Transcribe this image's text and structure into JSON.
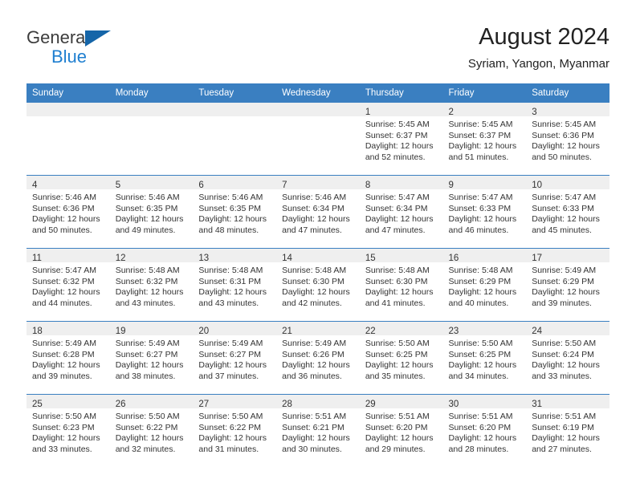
{
  "brand": {
    "line1": "General",
    "line2": "Blue",
    "flag_icon": "triangle-flag-icon",
    "accent_color": "#1565a8",
    "blue_text_color": "#1f7fd0"
  },
  "header": {
    "title": "August 2024",
    "subtitle": "Syriam, Yangon, Myanmar"
  },
  "calendar": {
    "header_bg": "#3a7fc1",
    "header_text_color": "#ffffff",
    "daynum_strip_bg": "#efefef",
    "weekday_headers": [
      "Sunday",
      "Monday",
      "Tuesday",
      "Wednesday",
      "Thursday",
      "Friday",
      "Saturday"
    ],
    "weeks": [
      [
        {
          "day": "",
          "sunrise": "",
          "sunset": "",
          "daylight1": "",
          "daylight2": ""
        },
        {
          "day": "",
          "sunrise": "",
          "sunset": "",
          "daylight1": "",
          "daylight2": ""
        },
        {
          "day": "",
          "sunrise": "",
          "sunset": "",
          "daylight1": "",
          "daylight2": ""
        },
        {
          "day": "",
          "sunrise": "",
          "sunset": "",
          "daylight1": "",
          "daylight2": ""
        },
        {
          "day": "1",
          "sunrise": "Sunrise: 5:45 AM",
          "sunset": "Sunset: 6:37 PM",
          "daylight1": "Daylight: 12 hours",
          "daylight2": "and 52 minutes."
        },
        {
          "day": "2",
          "sunrise": "Sunrise: 5:45 AM",
          "sunset": "Sunset: 6:37 PM",
          "daylight1": "Daylight: 12 hours",
          "daylight2": "and 51 minutes."
        },
        {
          "day": "3",
          "sunrise": "Sunrise: 5:45 AM",
          "sunset": "Sunset: 6:36 PM",
          "daylight1": "Daylight: 12 hours",
          "daylight2": "and 50 minutes."
        }
      ],
      [
        {
          "day": "4",
          "sunrise": "Sunrise: 5:46 AM",
          "sunset": "Sunset: 6:36 PM",
          "daylight1": "Daylight: 12 hours",
          "daylight2": "and 50 minutes."
        },
        {
          "day": "5",
          "sunrise": "Sunrise: 5:46 AM",
          "sunset": "Sunset: 6:35 PM",
          "daylight1": "Daylight: 12 hours",
          "daylight2": "and 49 minutes."
        },
        {
          "day": "6",
          "sunrise": "Sunrise: 5:46 AM",
          "sunset": "Sunset: 6:35 PM",
          "daylight1": "Daylight: 12 hours",
          "daylight2": "and 48 minutes."
        },
        {
          "day": "7",
          "sunrise": "Sunrise: 5:46 AM",
          "sunset": "Sunset: 6:34 PM",
          "daylight1": "Daylight: 12 hours",
          "daylight2": "and 47 minutes."
        },
        {
          "day": "8",
          "sunrise": "Sunrise: 5:47 AM",
          "sunset": "Sunset: 6:34 PM",
          "daylight1": "Daylight: 12 hours",
          "daylight2": "and 47 minutes."
        },
        {
          "day": "9",
          "sunrise": "Sunrise: 5:47 AM",
          "sunset": "Sunset: 6:33 PM",
          "daylight1": "Daylight: 12 hours",
          "daylight2": "and 46 minutes."
        },
        {
          "day": "10",
          "sunrise": "Sunrise: 5:47 AM",
          "sunset": "Sunset: 6:33 PM",
          "daylight1": "Daylight: 12 hours",
          "daylight2": "and 45 minutes."
        }
      ],
      [
        {
          "day": "11",
          "sunrise": "Sunrise: 5:47 AM",
          "sunset": "Sunset: 6:32 PM",
          "daylight1": "Daylight: 12 hours",
          "daylight2": "and 44 minutes."
        },
        {
          "day": "12",
          "sunrise": "Sunrise: 5:48 AM",
          "sunset": "Sunset: 6:32 PM",
          "daylight1": "Daylight: 12 hours",
          "daylight2": "and 43 minutes."
        },
        {
          "day": "13",
          "sunrise": "Sunrise: 5:48 AM",
          "sunset": "Sunset: 6:31 PM",
          "daylight1": "Daylight: 12 hours",
          "daylight2": "and 43 minutes."
        },
        {
          "day": "14",
          "sunrise": "Sunrise: 5:48 AM",
          "sunset": "Sunset: 6:30 PM",
          "daylight1": "Daylight: 12 hours",
          "daylight2": "and 42 minutes."
        },
        {
          "day": "15",
          "sunrise": "Sunrise: 5:48 AM",
          "sunset": "Sunset: 6:30 PM",
          "daylight1": "Daylight: 12 hours",
          "daylight2": "and 41 minutes."
        },
        {
          "day": "16",
          "sunrise": "Sunrise: 5:48 AM",
          "sunset": "Sunset: 6:29 PM",
          "daylight1": "Daylight: 12 hours",
          "daylight2": "and 40 minutes."
        },
        {
          "day": "17",
          "sunrise": "Sunrise: 5:49 AM",
          "sunset": "Sunset: 6:29 PM",
          "daylight1": "Daylight: 12 hours",
          "daylight2": "and 39 minutes."
        }
      ],
      [
        {
          "day": "18",
          "sunrise": "Sunrise: 5:49 AM",
          "sunset": "Sunset: 6:28 PM",
          "daylight1": "Daylight: 12 hours",
          "daylight2": "and 39 minutes."
        },
        {
          "day": "19",
          "sunrise": "Sunrise: 5:49 AM",
          "sunset": "Sunset: 6:27 PM",
          "daylight1": "Daylight: 12 hours",
          "daylight2": "and 38 minutes."
        },
        {
          "day": "20",
          "sunrise": "Sunrise: 5:49 AM",
          "sunset": "Sunset: 6:27 PM",
          "daylight1": "Daylight: 12 hours",
          "daylight2": "and 37 minutes."
        },
        {
          "day": "21",
          "sunrise": "Sunrise: 5:49 AM",
          "sunset": "Sunset: 6:26 PM",
          "daylight1": "Daylight: 12 hours",
          "daylight2": "and 36 minutes."
        },
        {
          "day": "22",
          "sunrise": "Sunrise: 5:50 AM",
          "sunset": "Sunset: 6:25 PM",
          "daylight1": "Daylight: 12 hours",
          "daylight2": "and 35 minutes."
        },
        {
          "day": "23",
          "sunrise": "Sunrise: 5:50 AM",
          "sunset": "Sunset: 6:25 PM",
          "daylight1": "Daylight: 12 hours",
          "daylight2": "and 34 minutes."
        },
        {
          "day": "24",
          "sunrise": "Sunrise: 5:50 AM",
          "sunset": "Sunset: 6:24 PM",
          "daylight1": "Daylight: 12 hours",
          "daylight2": "and 33 minutes."
        }
      ],
      [
        {
          "day": "25",
          "sunrise": "Sunrise: 5:50 AM",
          "sunset": "Sunset: 6:23 PM",
          "daylight1": "Daylight: 12 hours",
          "daylight2": "and 33 minutes."
        },
        {
          "day": "26",
          "sunrise": "Sunrise: 5:50 AM",
          "sunset": "Sunset: 6:22 PM",
          "daylight1": "Daylight: 12 hours",
          "daylight2": "and 32 minutes."
        },
        {
          "day": "27",
          "sunrise": "Sunrise: 5:50 AM",
          "sunset": "Sunset: 6:22 PM",
          "daylight1": "Daylight: 12 hours",
          "daylight2": "and 31 minutes."
        },
        {
          "day": "28",
          "sunrise": "Sunrise: 5:51 AM",
          "sunset": "Sunset: 6:21 PM",
          "daylight1": "Daylight: 12 hours",
          "daylight2": "and 30 minutes."
        },
        {
          "day": "29",
          "sunrise": "Sunrise: 5:51 AM",
          "sunset": "Sunset: 6:20 PM",
          "daylight1": "Daylight: 12 hours",
          "daylight2": "and 29 minutes."
        },
        {
          "day": "30",
          "sunrise": "Sunrise: 5:51 AM",
          "sunset": "Sunset: 6:20 PM",
          "daylight1": "Daylight: 12 hours",
          "daylight2": "and 28 minutes."
        },
        {
          "day": "31",
          "sunrise": "Sunrise: 5:51 AM",
          "sunset": "Sunset: 6:19 PM",
          "daylight1": "Daylight: 12 hours",
          "daylight2": "and 27 minutes."
        }
      ]
    ]
  }
}
